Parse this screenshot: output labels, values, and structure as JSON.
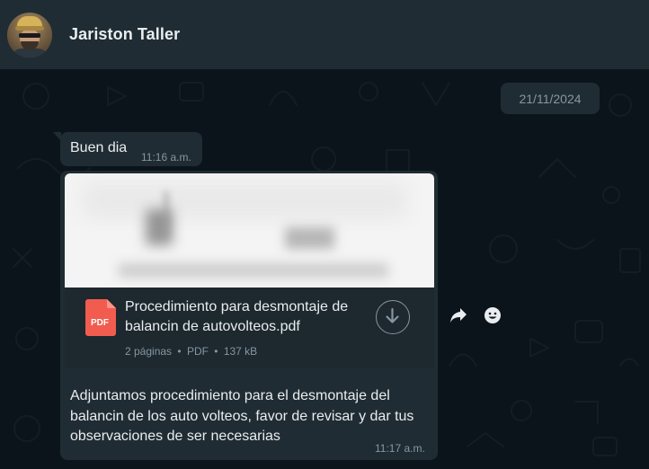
{
  "header": {
    "contact_name": "Jariston Taller"
  },
  "chat": {
    "date_divider": "21/11/2024",
    "messages": [
      {
        "text": "Buen dia",
        "time": "11:16 a.m."
      },
      {
        "document": {
          "file_name": "Procedimiento para desmontaje de balancin de autovolteos.pdf",
          "pages": "2 páginas",
          "type": "PDF",
          "size": "137 kB",
          "separator": "•",
          "icon_label": "PDF"
        },
        "caption": "Adjuntamos procedimiento para el desmontaje del balancin de los auto volteos, favor de revisar y dar tus observaciones de ser necesarias",
        "time": "11:17 a.m."
      }
    ]
  },
  "icons": {
    "download": "download-icon",
    "forward": "forward-icon",
    "emoji": "emoji-icon",
    "pdf": "pdf-icon"
  },
  "colors": {
    "header_bg": "#1f2c33",
    "chat_bg": "#0b141a",
    "bubble_bg": "#202c33",
    "pdf_red": "#f15c4f",
    "text_primary": "#e9edef",
    "text_secondary": "#8696a0"
  }
}
